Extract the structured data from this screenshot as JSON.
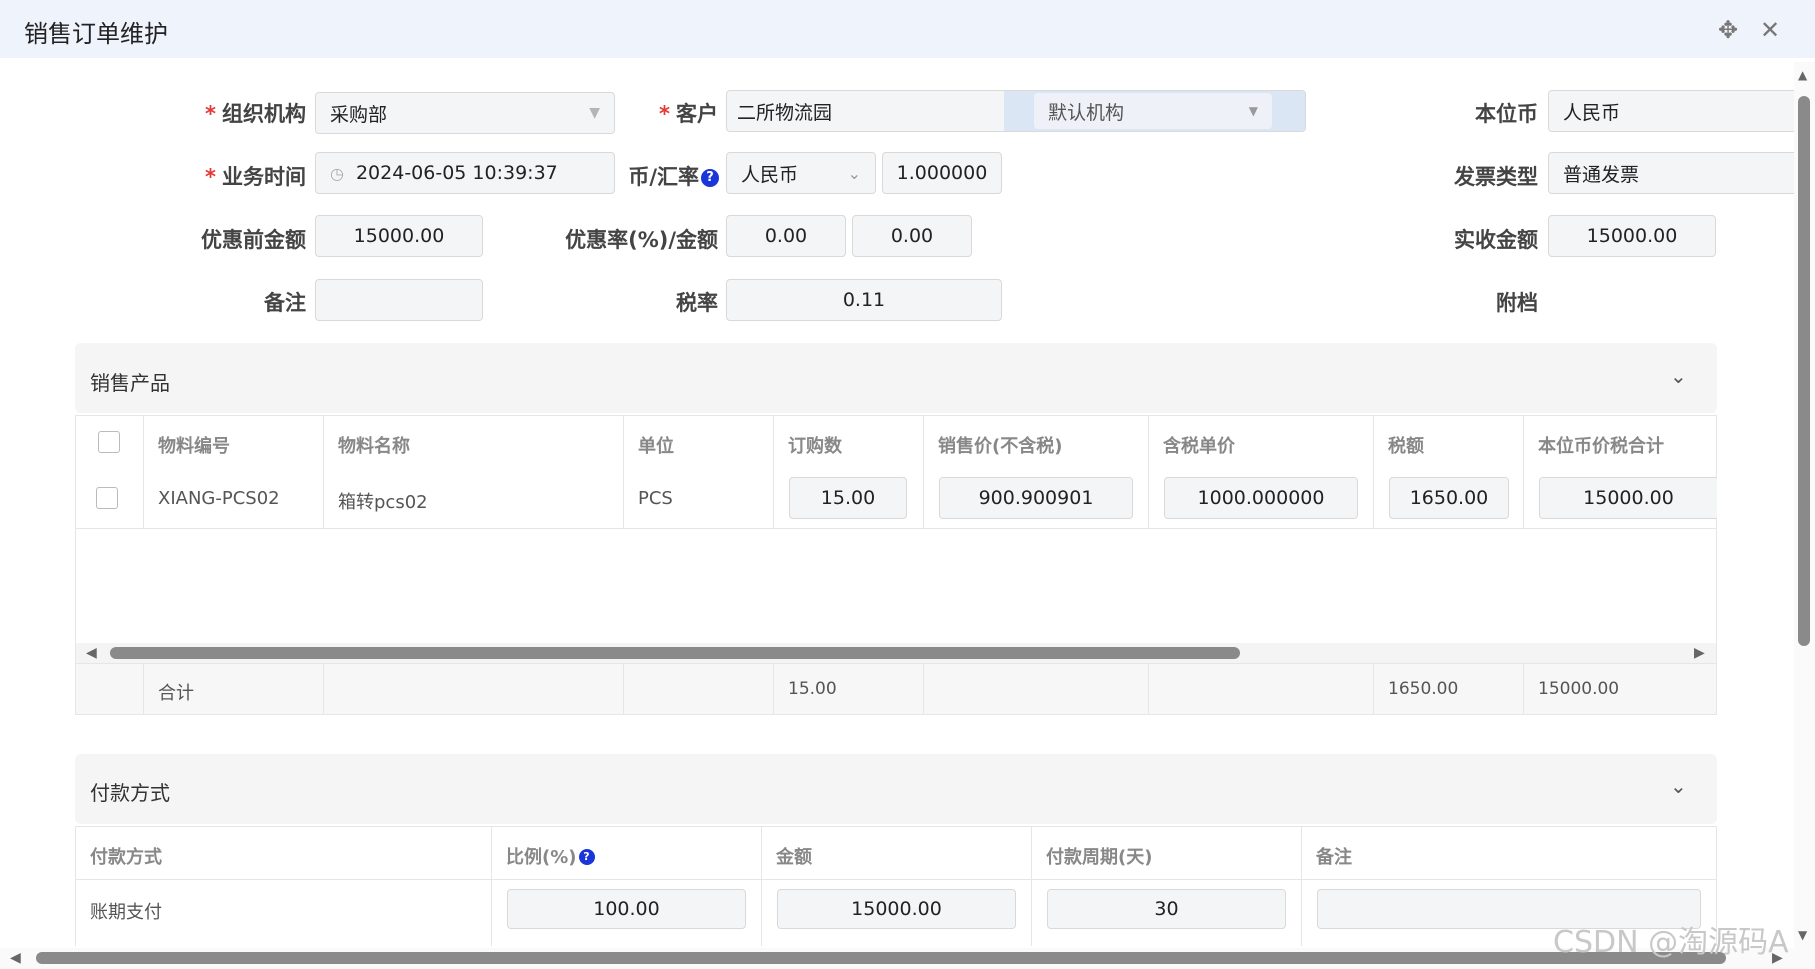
{
  "window": {
    "title": "销售订单维护"
  },
  "icons": {
    "move": "move-icon",
    "close": "close-icon",
    "clock": "clock-icon",
    "help": "help-icon",
    "chevron": "chevron-down-icon"
  },
  "form": {
    "org": {
      "label": "组织机构",
      "value": "采购部"
    },
    "customer": {
      "label": "客户",
      "value": "二所物流园",
      "sub_value": "默认机构"
    },
    "base_currency": {
      "label": "本位币",
      "value": "人民币"
    },
    "biz_time": {
      "label": "业务时间",
      "value": "2024-06-05 10:39:37"
    },
    "currency_rate": {
      "label": "币/汇率",
      "currency": "人民币",
      "rate": "1.000000"
    },
    "invoice_type": {
      "label": "发票类型",
      "value": "普通发票"
    },
    "pre_discount": {
      "label": "优惠前金额",
      "value": "15000.00"
    },
    "discount": {
      "label": "优惠率(%)/金额",
      "rate": "0.00",
      "amount": "0.00"
    },
    "actual_amount": {
      "label": "实收金额",
      "value": "15000.00"
    },
    "remark": {
      "label": "备注",
      "value": ""
    },
    "tax_rate": {
      "label": "税率",
      "value": "0.11"
    },
    "attachment": {
      "label": "附档"
    }
  },
  "products": {
    "title": "销售产品",
    "columns": [
      "物料编号",
      "物料名称",
      "单位",
      "订购数",
      "销售价(不含税)",
      "含税单价",
      "税额",
      "本位币价税合计"
    ],
    "rows": [
      {
        "code": "XIANG-PCS02",
        "name": "箱转pcs02",
        "unit": "PCS",
        "qty": "15.00",
        "price": "900.900901",
        "tax_price": "1000.000000",
        "tax": "1650.00",
        "total": "15000.00"
      }
    ],
    "summary": {
      "label": "合计",
      "qty": "15.00",
      "tax": "1650.00",
      "total": "15000.00"
    },
    "scroll_fraction": 0.6
  },
  "payment": {
    "title": "付款方式",
    "columns": [
      "付款方式",
      "比例(%)",
      "金额",
      "付款周期(天)",
      "备注"
    ],
    "rows": [
      {
        "method": "账期支付",
        "ratio": "100.00",
        "amount": "15000.00",
        "period": "30",
        "remark": ""
      }
    ]
  },
  "watermark": "CSDN @淘源码A"
}
